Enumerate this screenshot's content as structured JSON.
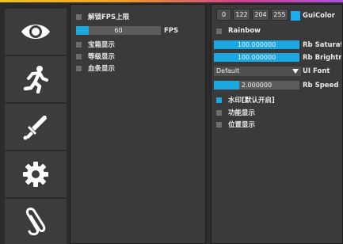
{
  "colors": {
    "accent": "#1ba7e0",
    "gui_color": "#1bacf0"
  },
  "sidebar": {
    "items": [
      {
        "icon": "eye-icon"
      },
      {
        "icon": "running-person-icon"
      },
      {
        "icon": "sword-icon"
      },
      {
        "icon": "gear-icon"
      },
      {
        "icon": "paperclip-icon"
      }
    ]
  },
  "mid_panel": {
    "unlock_fps": {
      "label": "解锁FPS上限",
      "checked": false
    },
    "fps": {
      "value": "60",
      "label": "FPS",
      "level": 0.15
    },
    "chest_display": {
      "label": "宝箱显示",
      "checked": false
    },
    "level_display": {
      "label": "等级显示",
      "checked": false
    },
    "hp_display": {
      "label": "血条显示",
      "checked": false
    }
  },
  "right_panel": {
    "gui_color": {
      "r": "0",
      "g": "122",
      "b": "204",
      "a": "255",
      "label": "GuiColor"
    },
    "rainbow": {
      "label": "Rainbow",
      "checked": false
    },
    "rb_saturation": {
      "value": "100.000000",
      "label": "Rb Saturation",
      "level": 1.0
    },
    "rb_brightness": {
      "value": "100.000000",
      "label": "Rb Brightness",
      "level": 1.0
    },
    "ui_font": {
      "value": "Default",
      "label": "UI Font"
    },
    "rb_speed": {
      "value": "2.000000",
      "label": "Rb Speed",
      "level": 0.3
    },
    "watermark": {
      "label": "水印[默认开启]",
      "checked": true
    },
    "feature_display": {
      "label": "功能显示",
      "checked": false
    },
    "position_display": {
      "label": "位置显示",
      "checked": false
    }
  }
}
